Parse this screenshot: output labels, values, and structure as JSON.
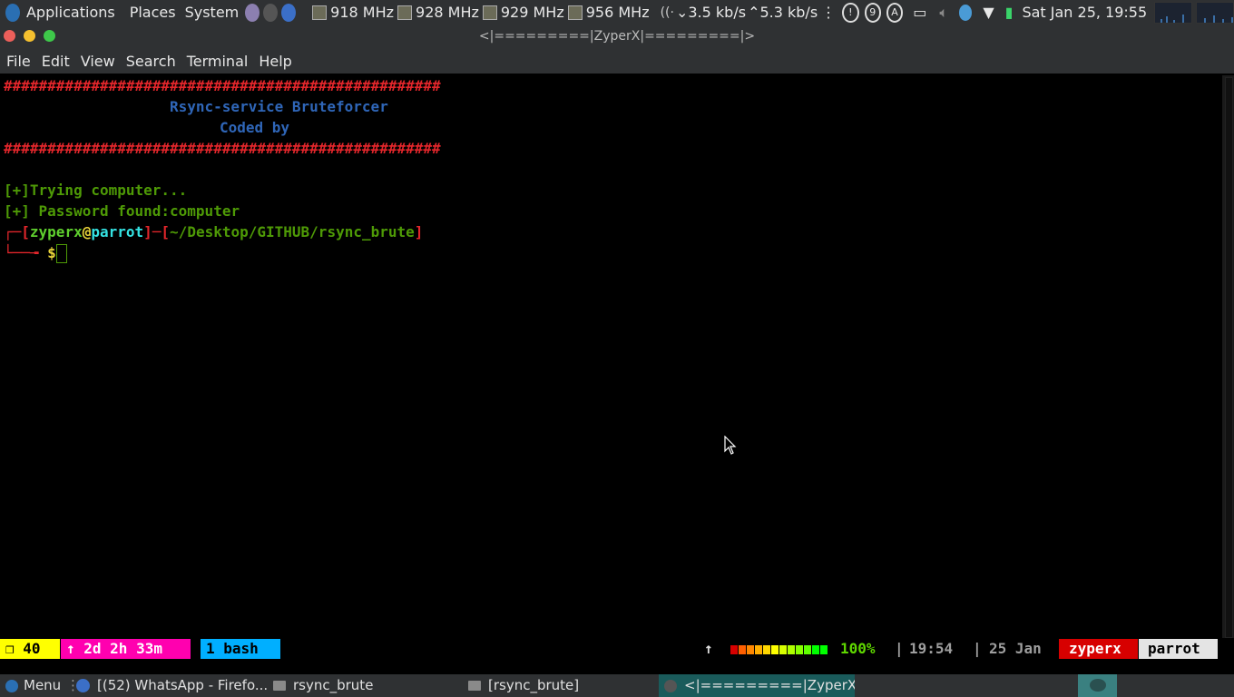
{
  "topbar": {
    "menus": [
      "Applications",
      "Places",
      "System"
    ],
    "cpu_freqs": [
      "918 MHz",
      "928 MHz",
      "929 MHz",
      "956 MHz"
    ],
    "net_down": "3.5 kb/s",
    "net_up": "5.3 kb/s",
    "tray_badges": [
      "9",
      "A"
    ],
    "datetime": "Sat Jan 25, 19:55"
  },
  "window": {
    "title": "<|=========|ZyperX|=========|>",
    "menu": [
      "File",
      "Edit",
      "View",
      "Search",
      "Terminal",
      "Help"
    ]
  },
  "terminal": {
    "hash_line": "##################################################",
    "banner_title": "Rsync-service Bruteforcer",
    "banner_coded": "Coded by",
    "trying": "[+]Trying computer...",
    "found": "[+] Password found:computer",
    "prompt_user": "zyperx",
    "prompt_at": "@",
    "prompt_host": "parrot",
    "prompt_path": "~/Desktop/GITHUB/rsync_brute",
    "prompt_symbol": "$"
  },
  "tmux": {
    "count": "❐ 40",
    "uptime": "↑ 2d 2h 33m",
    "window": "1 bash",
    "arrow": "↑",
    "battery": "100%",
    "sep": "|",
    "time": "19:54",
    "date": "25 Jan",
    "user": "zyperx",
    "host": "parrot"
  },
  "taskbar": {
    "menu_label": "Menu",
    "tasks": [
      "[(52) WhatsApp - Firefo...",
      "rsync_brute",
      "[rsync_brute]",
      "<|=========|ZyperX|=..."
    ]
  },
  "colors": {
    "panel_bg": "#2f3133",
    "hash_red": "#e3262b",
    "banner_blue": "#2f66b8",
    "output_green": "#4e9a06",
    "tmux_yellow": "#ffff00",
    "tmux_magenta": "#ff00af",
    "tmux_cyan": "#00afff",
    "tmux_red": "#d70000"
  }
}
